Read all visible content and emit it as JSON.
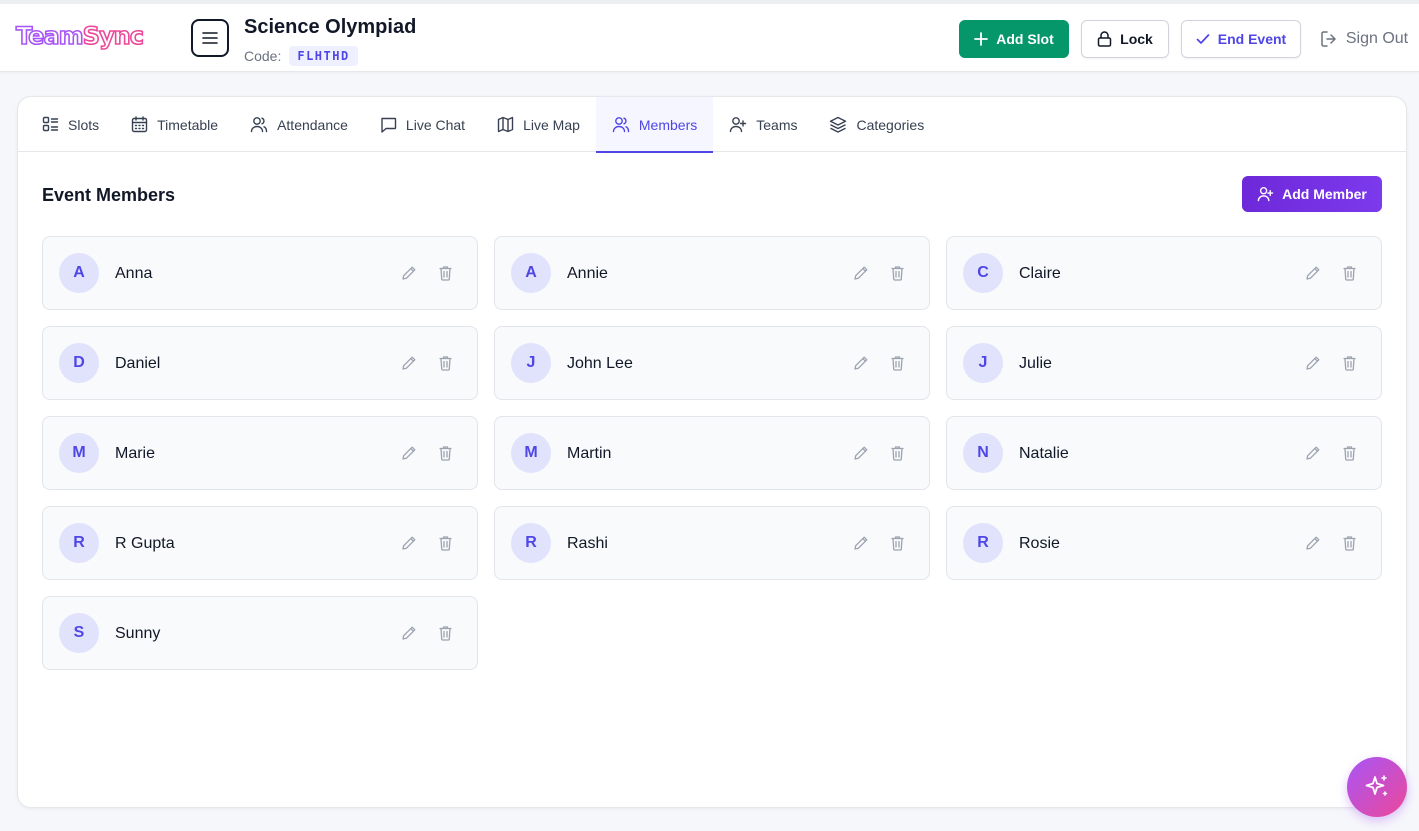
{
  "app": {
    "brand_part1": "Team",
    "brand_part2": "Sync",
    "brand_primary": "#a855f7",
    "brand_secondary": "#ec4899"
  },
  "header": {
    "event_title": "Science Olympiad",
    "code_label": "Code:",
    "code_value": "FLHTHD",
    "add_slot_label": "Add Slot",
    "lock_label": "Lock",
    "end_event_label": "End Event",
    "sign_out_label": "Sign Out"
  },
  "tabs": [
    {
      "label": "Slots",
      "icon": "slots-icon"
    },
    {
      "label": "Timetable",
      "icon": "calendar-icon"
    },
    {
      "label": "Attendance",
      "icon": "users-icon"
    },
    {
      "label": "Live Chat",
      "icon": "chat-icon"
    },
    {
      "label": "Live Map",
      "icon": "map-icon"
    },
    {
      "label": "Members",
      "icon": "users-icon",
      "active": true
    },
    {
      "label": "Teams",
      "icon": "user-plus-icon"
    },
    {
      "label": "Categories",
      "icon": "layers-icon"
    }
  ],
  "members_section": {
    "title": "Event Members",
    "add_member_label": "Add Member",
    "members": [
      {
        "initial": "A",
        "name": "Anna"
      },
      {
        "initial": "A",
        "name": "Annie"
      },
      {
        "initial": "C",
        "name": "Claire"
      },
      {
        "initial": "D",
        "name": "Daniel"
      },
      {
        "initial": "J",
        "name": "John Lee"
      },
      {
        "initial": "J",
        "name": "Julie"
      },
      {
        "initial": "M",
        "name": "Marie"
      },
      {
        "initial": "M",
        "name": "Martin"
      },
      {
        "initial": "N",
        "name": "Natalie"
      },
      {
        "initial": "R",
        "name": "R Gupta"
      },
      {
        "initial": "R",
        "name": "Rashi"
      },
      {
        "initial": "R",
        "name": "Rosie"
      },
      {
        "initial": "S",
        "name": "Sunny"
      }
    ]
  },
  "colors": {
    "accent": "#4f46e5",
    "success": "#059669",
    "purple": "#6d28d9"
  }
}
